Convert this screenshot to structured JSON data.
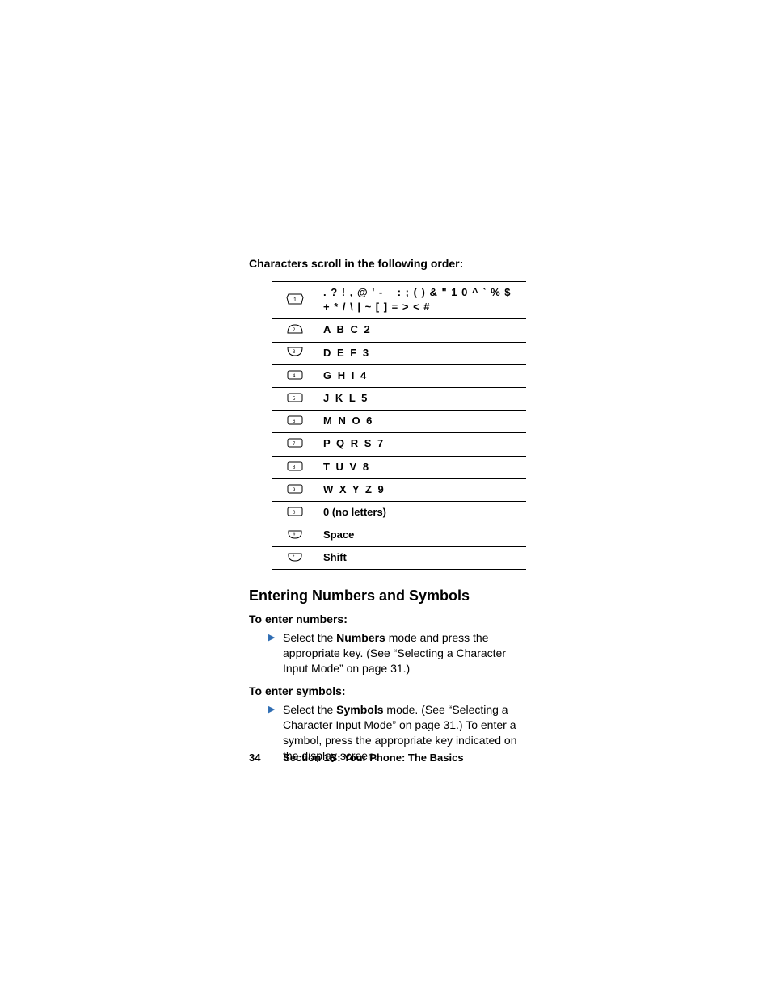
{
  "intro": "Characters scroll in the following order:",
  "rows": [
    {
      "key": "1",
      "chars": ". ? ! , @ ' - _ : ; ( ) & \" 1 0 ^ ` % $ + * / \\ | ~ [ ] = > < #"
    },
    {
      "key": "2",
      "chars": "A B C 2"
    },
    {
      "key": "3",
      "chars": "D E F 3"
    },
    {
      "key": "4",
      "chars": "G H I 4"
    },
    {
      "key": "5",
      "chars": "J K L 5"
    },
    {
      "key": "6",
      "chars": "M N O 6"
    },
    {
      "key": "7",
      "chars": "P Q R S 7"
    },
    {
      "key": "8",
      "chars": "T U V 8"
    },
    {
      "key": "9",
      "chars": "W X Y Z 9"
    },
    {
      "key": "0",
      "chars": "0 (no letters)"
    },
    {
      "key": "space",
      "chars": "Space"
    },
    {
      "key": "shift",
      "chars": "Shift"
    }
  ],
  "section_heading": "Entering Numbers and Symbols",
  "numbers_sub": "To enter numbers:",
  "numbers_text_pre": "Select the ",
  "numbers_text_bold": "Numbers",
  "numbers_text_post": " mode and press the appropriate key. (See “Selecting a Character Input Mode” on page 31.)",
  "symbols_sub": "To enter symbols:",
  "symbols_text_pre": "Select the ",
  "symbols_text_bold": "Symbols",
  "symbols_text_post": " mode. (See “Selecting a Character Input Mode” on page 31.) To enter a symbol, press the appropriate key indicated on the display screen.",
  "page_number": "34",
  "footer_section": "Section 1B: Your Phone: The Basics"
}
